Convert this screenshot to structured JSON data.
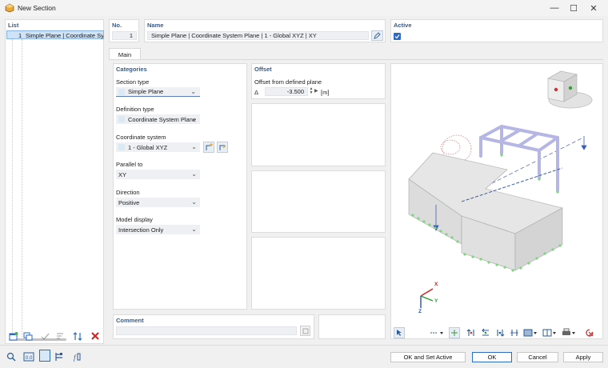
{
  "window": {
    "title": "New Section",
    "minimize": "—",
    "maximize": "☐",
    "close": "✕"
  },
  "list": {
    "header": "List",
    "items": [
      {
        "no": "1",
        "label": "Simple Plane | Coordinate Syste"
      }
    ]
  },
  "no": {
    "header": "No.",
    "value": "1"
  },
  "name": {
    "header": "Name",
    "value": "Simple Plane | Coordinate System Plane | 1 - Global XYZ | XY"
  },
  "active": {
    "header": "Active",
    "checked": true
  },
  "tabs": [
    {
      "label": "Main"
    }
  ],
  "categories": {
    "header": "Categories",
    "section_type": {
      "label": "Section type",
      "value": "Simple Plane"
    },
    "definition_type": {
      "label": "Definition type",
      "value": "Coordinate System Plane"
    },
    "coordinate_system": {
      "label": "Coordinate system",
      "value": "1 - Global XYZ"
    },
    "parallel_to": {
      "label": "Parallel to",
      "value": "XY"
    },
    "direction": {
      "label": "Direction",
      "value": "Positive"
    },
    "model_display": {
      "label": "Model display",
      "value": "Intersection Only"
    }
  },
  "offset": {
    "header": "Offset",
    "label": "Offset from defined plane",
    "symbol": "Δ",
    "value": "-3.500",
    "unit": "[m]"
  },
  "comment": {
    "header": "Comment",
    "value": ""
  },
  "viewer": {
    "axis_x": "X",
    "axis_y": "Y",
    "axis_z": "Z"
  },
  "buttons": {
    "ok_and_set_active": "OK and Set Active",
    "ok": "OK",
    "cancel": "Cancel",
    "apply": "Apply"
  },
  "colors": {
    "accent": "#2d6bc4",
    "header_text": "#3a5b86",
    "member": "#b8b8e0",
    "support": "#7ed67e"
  }
}
